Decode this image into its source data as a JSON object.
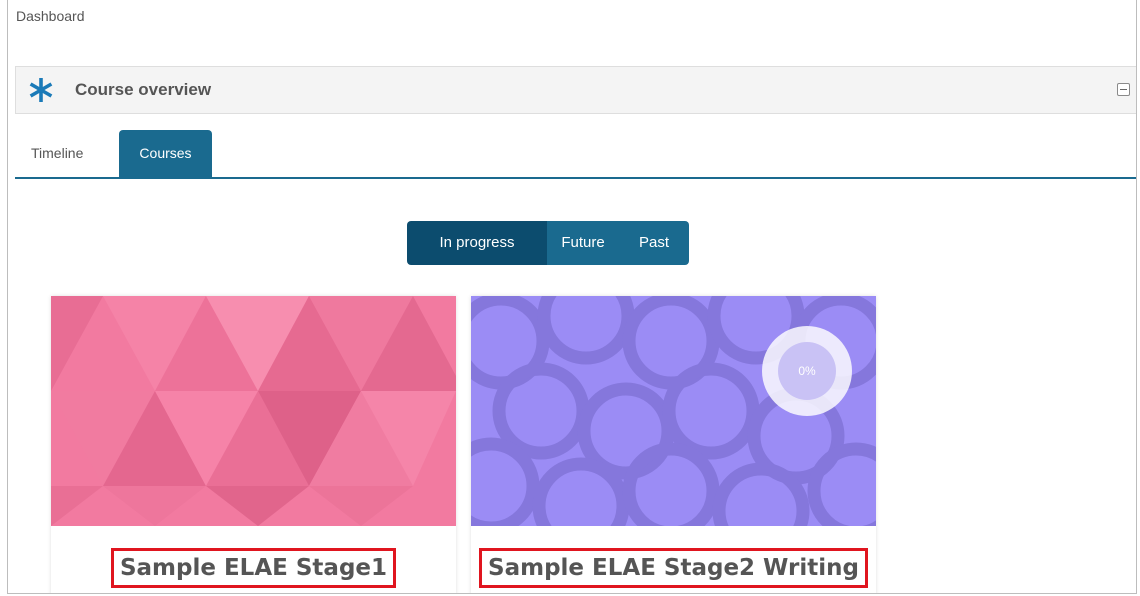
{
  "breadcrumb": "Dashboard",
  "block": {
    "title": "Course overview",
    "icon": "asterisk-icon",
    "accent": "#1a6a8f"
  },
  "tabs": [
    {
      "label": "Timeline",
      "active": false
    },
    {
      "label": "Courses",
      "active": true
    }
  ],
  "filter": {
    "options": [
      "In progress",
      "Future",
      "Past"
    ],
    "selected": "In progress"
  },
  "courses": [
    {
      "name": "Sample ELAE Stage1",
      "image_color": "#f27aa0",
      "progress_label": ""
    },
    {
      "name": "Sample ELAE Stage2 Writing",
      "image_color": "#9b8cf5",
      "progress_label": "0%"
    }
  ],
  "colors": {
    "tab_active": "#1a6a8f",
    "filter_active": "#0c4c6e",
    "highlight_border": "#e0151f"
  }
}
